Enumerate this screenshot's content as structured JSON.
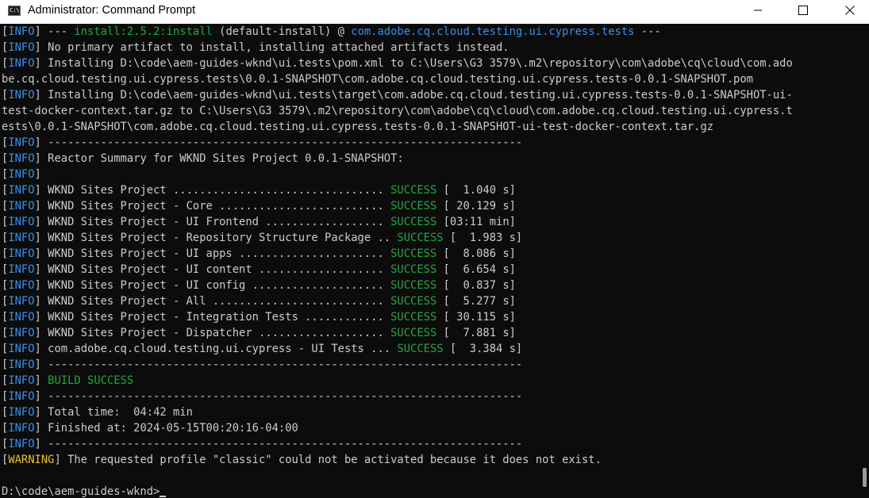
{
  "window": {
    "title": "Administrator: Command Prompt",
    "icon_text": "C:\\."
  },
  "console": {
    "lines": [
      [
        {
          "t": "["
        },
        {
          "t": "INFO",
          "c": "blue"
        },
        {
          "t": "] --- "
        },
        {
          "t": "install:2.5.2:install",
          "c": "green"
        },
        {
          "t": " (default-install) @ "
        },
        {
          "t": "com.adobe.cq.cloud.testing.ui.cypress.tests",
          "c": "blue"
        },
        {
          "t": " ---"
        }
      ],
      [
        {
          "t": "["
        },
        {
          "t": "INFO",
          "c": "blue"
        },
        {
          "t": "] No primary artifact to install, installing attached artifacts instead."
        }
      ],
      [
        {
          "t": "["
        },
        {
          "t": "INFO",
          "c": "blue"
        },
        {
          "t": "] Installing D:\\code\\aem-guides-wknd\\ui.tests\\pom.xml to C:\\Users\\G3 3579\\.m2\\repository\\com\\adobe\\cq\\cloud\\com.ado"
        }
      ],
      [
        {
          "t": "be.cq.cloud.testing.ui.cypress.tests\\0.0.1-SNAPSHOT\\com.adobe.cq.cloud.testing.ui.cypress.tests-0.0.1-SNAPSHOT.pom"
        }
      ],
      [
        {
          "t": "["
        },
        {
          "t": "INFO",
          "c": "blue"
        },
        {
          "t": "] Installing D:\\code\\aem-guides-wknd\\ui.tests\\target\\com.adobe.cq.cloud.testing.ui.cypress.tests-0.0.1-SNAPSHOT-ui-"
        }
      ],
      [
        {
          "t": "test-docker-context.tar.gz to C:\\Users\\G3 3579\\.m2\\repository\\com\\adobe\\cq\\cloud\\com.adobe.cq.cloud.testing.ui.cypress.t"
        }
      ],
      [
        {
          "t": "ests\\0.0.1-SNAPSHOT\\com.adobe.cq.cloud.testing.ui.cypress.tests-0.0.1-SNAPSHOT-ui-test-docker-context.tar.gz"
        }
      ],
      [
        {
          "t": "["
        },
        {
          "t": "INFO",
          "c": "blue"
        },
        {
          "t": "] ------------------------------------------------------------------------"
        }
      ],
      [
        {
          "t": "["
        },
        {
          "t": "INFO",
          "c": "blue"
        },
        {
          "t": "] Reactor Summary for WKND Sites Project 0.0.1-SNAPSHOT:"
        }
      ],
      [
        {
          "t": "["
        },
        {
          "t": "INFO",
          "c": "blue"
        },
        {
          "t": "]"
        }
      ],
      [
        {
          "t": "["
        },
        {
          "t": "INFO",
          "c": "blue"
        },
        {
          "t": "] WKND Sites Project ................................ "
        },
        {
          "t": "SUCCESS",
          "c": "green"
        },
        {
          "t": " [  1.040 s]"
        }
      ],
      [
        {
          "t": "["
        },
        {
          "t": "INFO",
          "c": "blue"
        },
        {
          "t": "] WKND Sites Project - Core ......................... "
        },
        {
          "t": "SUCCESS",
          "c": "green"
        },
        {
          "t": " [ 20.129 s]"
        }
      ],
      [
        {
          "t": "["
        },
        {
          "t": "INFO",
          "c": "blue"
        },
        {
          "t": "] WKND Sites Project - UI Frontend .................. "
        },
        {
          "t": "SUCCESS",
          "c": "green"
        },
        {
          "t": " [03:11 min]"
        }
      ],
      [
        {
          "t": "["
        },
        {
          "t": "INFO",
          "c": "blue"
        },
        {
          "t": "] WKND Sites Project - Repository Structure Package .. "
        },
        {
          "t": "SUCCESS",
          "c": "green"
        },
        {
          "t": " [  1.983 s]"
        }
      ],
      [
        {
          "t": "["
        },
        {
          "t": "INFO",
          "c": "blue"
        },
        {
          "t": "] WKND Sites Project - UI apps ...................... "
        },
        {
          "t": "SUCCESS",
          "c": "green"
        },
        {
          "t": " [  8.086 s]"
        }
      ],
      [
        {
          "t": "["
        },
        {
          "t": "INFO",
          "c": "blue"
        },
        {
          "t": "] WKND Sites Project - UI content ................... "
        },
        {
          "t": "SUCCESS",
          "c": "green"
        },
        {
          "t": " [  6.654 s]"
        }
      ],
      [
        {
          "t": "["
        },
        {
          "t": "INFO",
          "c": "blue"
        },
        {
          "t": "] WKND Sites Project - UI config .................... "
        },
        {
          "t": "SUCCESS",
          "c": "green"
        },
        {
          "t": " [  0.837 s]"
        }
      ],
      [
        {
          "t": "["
        },
        {
          "t": "INFO",
          "c": "blue"
        },
        {
          "t": "] WKND Sites Project - All .......................... "
        },
        {
          "t": "SUCCESS",
          "c": "green"
        },
        {
          "t": " [  5.277 s]"
        }
      ],
      [
        {
          "t": "["
        },
        {
          "t": "INFO",
          "c": "blue"
        },
        {
          "t": "] WKND Sites Project - Integration Tests ............ "
        },
        {
          "t": "SUCCESS",
          "c": "green"
        },
        {
          "t": " [ 30.115 s]"
        }
      ],
      [
        {
          "t": "["
        },
        {
          "t": "INFO",
          "c": "blue"
        },
        {
          "t": "] WKND Sites Project - Dispatcher ................... "
        },
        {
          "t": "SUCCESS",
          "c": "green"
        },
        {
          "t": " [  7.881 s]"
        }
      ],
      [
        {
          "t": "["
        },
        {
          "t": "INFO",
          "c": "blue"
        },
        {
          "t": "] com.adobe.cq.cloud.testing.ui.cypress - UI Tests ... "
        },
        {
          "t": "SUCCESS",
          "c": "green"
        },
        {
          "t": " [  3.384 s]"
        }
      ],
      [
        {
          "t": "["
        },
        {
          "t": "INFO",
          "c": "blue"
        },
        {
          "t": "] ------------------------------------------------------------------------"
        }
      ],
      [
        {
          "t": "["
        },
        {
          "t": "INFO",
          "c": "blue"
        },
        {
          "t": "] "
        },
        {
          "t": "BUILD SUCCESS",
          "c": "green"
        }
      ],
      [
        {
          "t": "["
        },
        {
          "t": "INFO",
          "c": "blue"
        },
        {
          "t": "] ------------------------------------------------------------------------"
        }
      ],
      [
        {
          "t": "["
        },
        {
          "t": "INFO",
          "c": "blue"
        },
        {
          "t": "] Total time:  04:42 min"
        }
      ],
      [
        {
          "t": "["
        },
        {
          "t": "INFO",
          "c": "blue"
        },
        {
          "t": "] Finished at: 2024-05-15T00:20:16-04:00"
        }
      ],
      [
        {
          "t": "["
        },
        {
          "t": "INFO",
          "c": "blue"
        },
        {
          "t": "] ------------------------------------------------------------------------"
        }
      ],
      [
        {
          "t": "["
        },
        {
          "t": "WARNING",
          "c": "yellow"
        },
        {
          "t": "] The requested profile \"classic\" could not be activated because it does not exist."
        }
      ],
      [
        {
          "t": ""
        }
      ]
    ],
    "prompt": "D:\\code\\aem-guides-wknd>"
  },
  "colors": {
    "background": "#0c0c0c",
    "text": "#cccccc",
    "info_blue": "#3b8eea",
    "success_green": "#23a83a",
    "warning_yellow": "#e5c32e"
  }
}
